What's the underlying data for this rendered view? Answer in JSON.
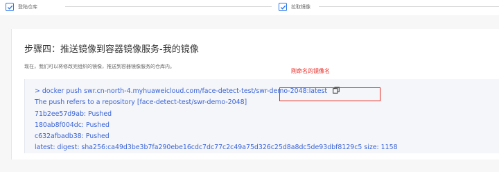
{
  "steps": {
    "login_repo_label": "登陆仓库",
    "pull_image_label": "拉取镜像"
  },
  "panel": {
    "title": "步骤四：推送镜像到容器镜像服务-我的镜像",
    "description": "现在，我们可以将修改完组织的镜像，推送到容器镜像服务的仓库内。",
    "annotation_label": "刚命名的镜像名",
    "code_lines": [
      "> docker push swr.cn-north-4.myhuaweicloud.com/face-detect-test/swr-demo-2048:latest",
      "The push refers to a repository [face-detect-test/swr-demo-2048]",
      "71b2ee57d9ab: Pushed",
      "180ab8f004dc: Pushed",
      "c632afbadb38: Pushed",
      "latest: digest: sha256:ca49d3be3b7fa290ebe16cdc7dc77c2c49a75d326c25d8a8dc5de93dbf8129c5 size: 1158"
    ]
  },
  "colors": {
    "accent": "#2b77e6",
    "annotation": "#e8261f",
    "code_text": "#3a63d6"
  },
  "icons": {
    "step_check": "checkbox-checked-icon",
    "copy": "copy-icon"
  }
}
